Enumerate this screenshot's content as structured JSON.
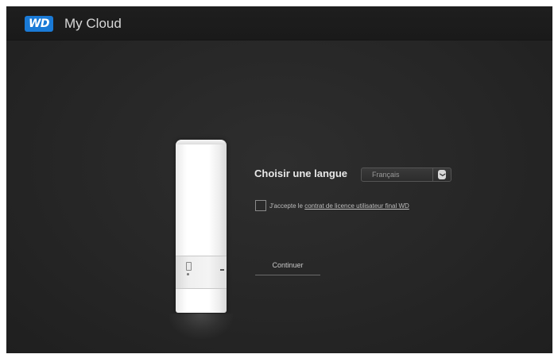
{
  "header": {
    "logo_text": "WD",
    "app_title": "My Cloud",
    "brand_color": "#1a7ad6"
  },
  "setup": {
    "language_label": "Choisir une langue",
    "language_value": "Français",
    "terms_prefix": "J'accepte le ",
    "terms_link": "contrat de licence utilisateur final WD",
    "terms_checked": false,
    "continue_label": "Continuer"
  },
  "icons": {
    "select_arrow": "chevron-down-icon"
  }
}
